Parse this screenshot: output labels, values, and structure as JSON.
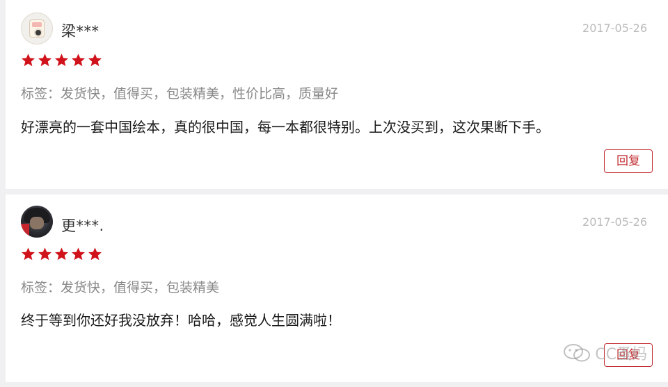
{
  "reviews": [
    {
      "username": "梁***",
      "date": "2017-05-26",
      "rating": 5,
      "tags": "标签：发货快，值得买，包装精美，性价比高，质量好",
      "content": "好漂亮的一套中国绘本，真的很中国，每一本都很特别。上次没买到，这次果断下手。",
      "reply_label": "回复",
      "avatar": "camera-avatar"
    },
    {
      "username": "更***.",
      "date": "2017-05-26",
      "rating": 5,
      "tags": "标签：发货快，值得买，包装精美",
      "content": "终于等到你还好我没放弃！哈哈，感觉人生圆满啦！",
      "reply_label": "回复",
      "avatar": "photo-avatar"
    }
  ],
  "watermark": {
    "text": "CC蚤妈",
    "icon": "wechat-icon"
  },
  "colors": {
    "star": "#d0121b",
    "accent": "#c33035",
    "date": "#bbbbbb",
    "tag": "#888888"
  }
}
